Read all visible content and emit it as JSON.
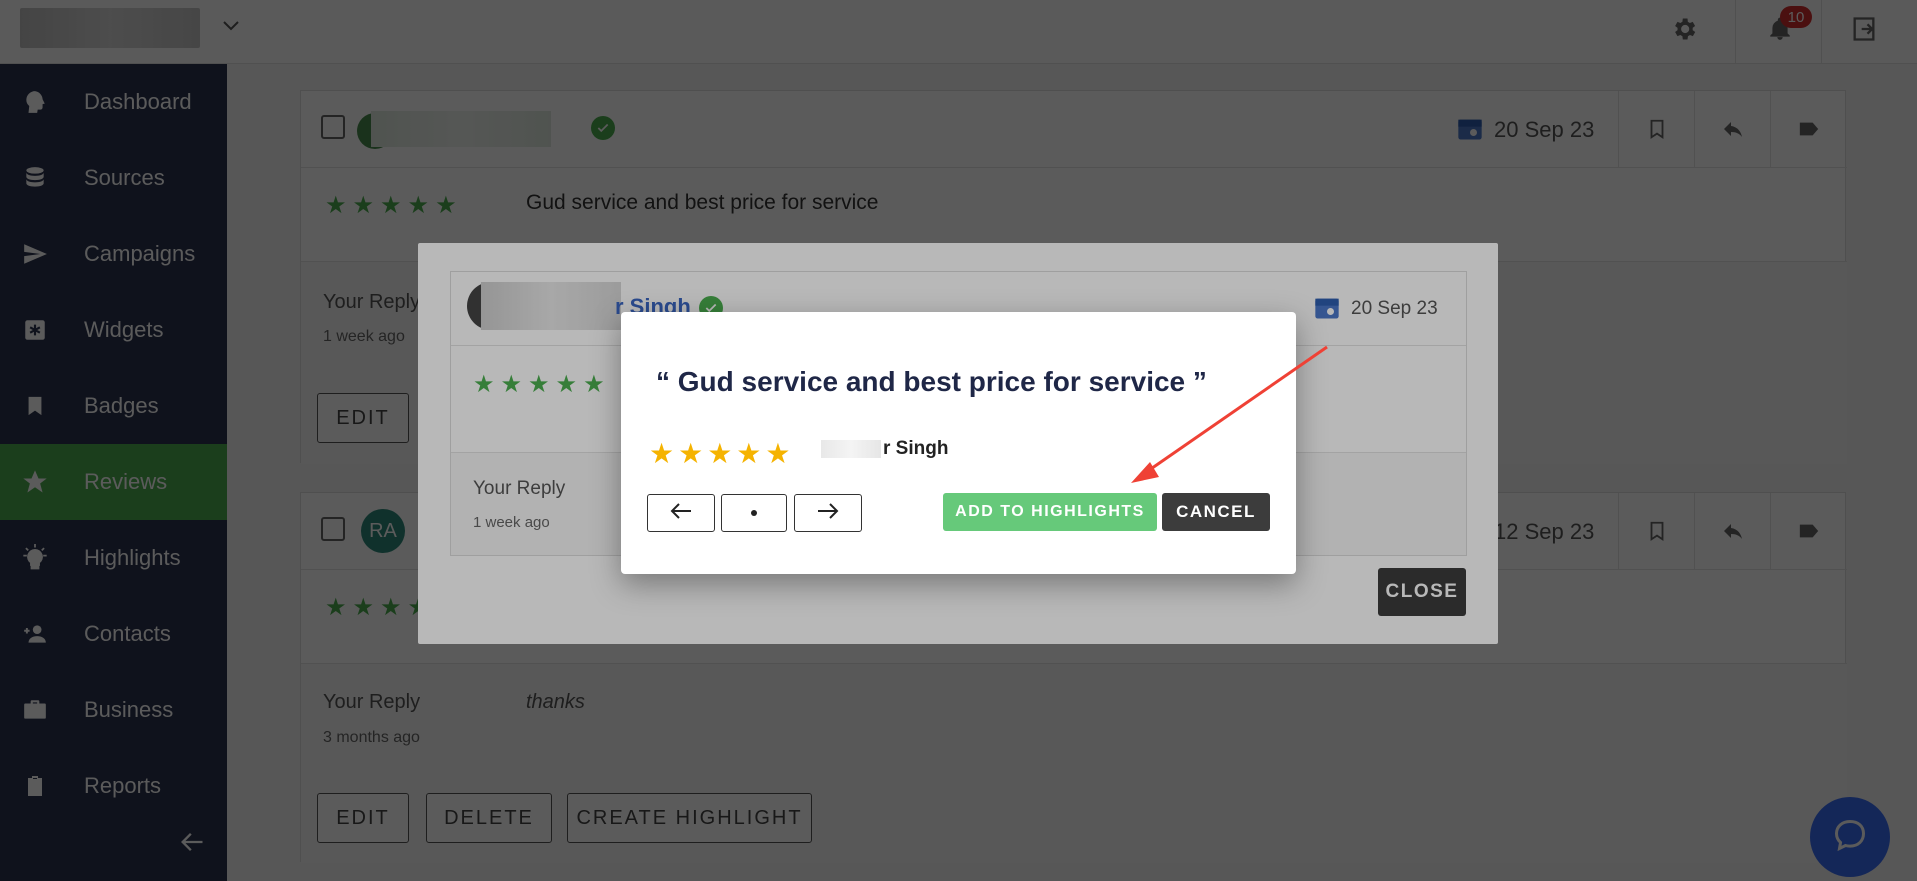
{
  "topbar": {
    "notification_count": "10"
  },
  "sidebar": {
    "items": [
      {
        "label": "Dashboard",
        "icon": "brain-icon"
      },
      {
        "label": "Sources",
        "icon": "database-icon"
      },
      {
        "label": "Campaigns",
        "icon": "send-icon"
      },
      {
        "label": "Widgets",
        "icon": "widget-icon"
      },
      {
        "label": "Badges",
        "icon": "bookmark-icon"
      },
      {
        "label": "Reviews",
        "icon": "star-icon",
        "active": true
      },
      {
        "label": "Highlights",
        "icon": "bulb-icon"
      },
      {
        "label": "Contacts",
        "icon": "contact-icon"
      },
      {
        "label": "Business",
        "icon": "briefcase-icon"
      },
      {
        "label": "Reports",
        "icon": "clipboard-icon"
      }
    ]
  },
  "review1": {
    "date": "20 Sep 23",
    "text": "Gud service and best price for service",
    "reply_label": "Your Reply",
    "reply_time": "1 week ago",
    "edit": "EDIT"
  },
  "review2": {
    "avatar": "RA",
    "date": "12 Sep 23",
    "reply_label": "Your Reply",
    "reply_text": "thanks",
    "reply_time": "3 months ago",
    "edit": "EDIT",
    "delete": "DELETE",
    "create_highlight": "CREATE HIGHLIGHT"
  },
  "modal1": {
    "reviewer_name": "r Singh",
    "date": "20 Sep 23",
    "reply_label": "Your Reply",
    "reply_time": "1 week ago",
    "close": "CLOSE"
  },
  "modal2": {
    "quote_open": "“",
    "quote_text": "Gud service and best price for service",
    "quote_close": "”",
    "rating": 5,
    "reviewer_name": "r Singh",
    "add_to_highlights": "ADD TO HIGHLIGHTS",
    "cancel": "CANCEL"
  },
  "colors": {
    "sidebar": "#2b3350",
    "accent_green": "#4caf50",
    "star_yellow": "#f5b301",
    "chat_blue": "#3b6df5"
  }
}
